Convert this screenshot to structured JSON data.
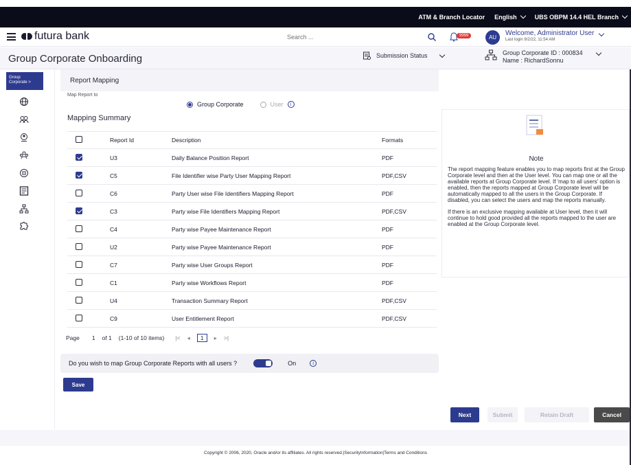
{
  "topbar": {
    "atm_locator": "ATM & Branch Locator",
    "language": "English",
    "branch": "UBS OBPM 14.4 HEL Branch"
  },
  "header": {
    "brand": "futura bank",
    "search_placeholder": "Search ...",
    "notification_count": "9999",
    "avatar_initials": "AU",
    "welcome": "Welcome, Administrator User",
    "last_login": "Last login 9/2/22, 11:54 AM"
  },
  "titlebar": {
    "title": "Group Corporate Onboarding",
    "submission_status": "Submission Status",
    "gc_id": "Group Corporate ID : 000834",
    "gc_name": "Name : RichardSonnu"
  },
  "rail": {
    "active_label_line1": "Group",
    "active_label_line2": "Corporate >"
  },
  "report_mapping": {
    "title": "Report Mapping",
    "map_to_label": "Map Report to",
    "option_group": "Group Corporate",
    "option_user": "User",
    "summary_title": "Mapping Summary",
    "columns": [
      "Report Id",
      "Description",
      "Formats"
    ],
    "rows": [
      {
        "checked": true,
        "id": "U3",
        "desc": "Daily Balance Position Report",
        "fmt": "PDF"
      },
      {
        "checked": true,
        "id": "C5",
        "desc": "File Identifier wise Party User Mapping Report",
        "fmt": "PDF,CSV"
      },
      {
        "checked": false,
        "id": "C6",
        "desc": "Party User wise File Identifiers Mapping Report",
        "fmt": "PDF"
      },
      {
        "checked": true,
        "id": "C3",
        "desc": "Party wise File Identifiers Mapping Report",
        "fmt": "PDF,CSV"
      },
      {
        "checked": false,
        "id": "C4",
        "desc": "Party wise Payee Maintenance Report",
        "fmt": "PDF"
      },
      {
        "checked": false,
        "id": "U2",
        "desc": "Party wise Payee Maintenance Report",
        "fmt": "PDF"
      },
      {
        "checked": false,
        "id": "C7",
        "desc": "Party wise User Groups Report",
        "fmt": "PDF"
      },
      {
        "checked": false,
        "id": "C1",
        "desc": "Party wise Workflows Report",
        "fmt": "PDF"
      },
      {
        "checked": false,
        "id": "U4",
        "desc": "Transaction Summary Report",
        "fmt": "PDF,CSV"
      },
      {
        "checked": false,
        "id": "C9",
        "desc": "User Entitlement Report",
        "fmt": "PDF,CSV"
      }
    ],
    "pager": {
      "page_label": "Page",
      "page": "1",
      "of": "of 1",
      "items": "(1-10 of 10 items)",
      "current": "1"
    },
    "toggle_question": "Do you wish to map Group Corporate Reports with all users ?",
    "toggle_state": "On",
    "save": "Save"
  },
  "note": {
    "title": "Note",
    "para1": "The report mapping feature enables you to map reports first at the Group Corporate level and then at the User level. You can map one or all the available reports at Group Corporate level. If 'map to all users' option is enabled, then the reports mapped at Group Corporate level will be automatically mapped to all the users in the Group Corporate. If disabled, you can select the users and map the reports manually.",
    "para2": "If there is an exclusive mapping available at User level, then it will continue to hold good provided all the reports mapped to the user are enabled at the Group Corporate level."
  },
  "actions": {
    "next": "Next",
    "submit": "Submit",
    "retain_draft": "Retain Draft",
    "cancel": "Cancel"
  },
  "footer": {
    "copyright": "Copyright © 2006, 2020, Oracle and/or its affiliates. All rights reserved.|SecurityInformation|Terms and Conditions"
  },
  "colors": {
    "primary": "#2d3b8f",
    "topbar": "#0b0c1a",
    "badge": "#e53935"
  }
}
